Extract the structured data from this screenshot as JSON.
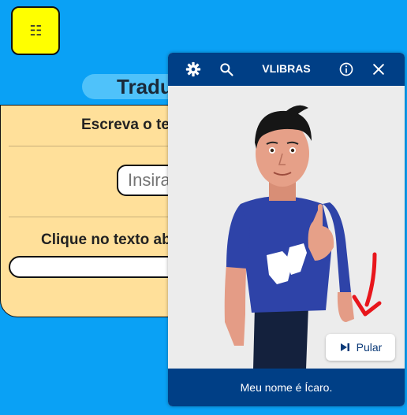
{
  "menu": {
    "glyph": "☷"
  },
  "page": {
    "title": "Tradutor"
  },
  "card": {
    "heading": "Escreva o texto",
    "input_placeholder": "Insira",
    "subheading": "Clique no texto abaixo"
  },
  "vlibras": {
    "title": "VLIBRAS",
    "skip_label": "Pular",
    "caption": "Meu nome é Ícaro.",
    "header_color": "#003f86",
    "body_color": "#ececec"
  },
  "annotation": {
    "arrow_color": "#e8161c"
  }
}
